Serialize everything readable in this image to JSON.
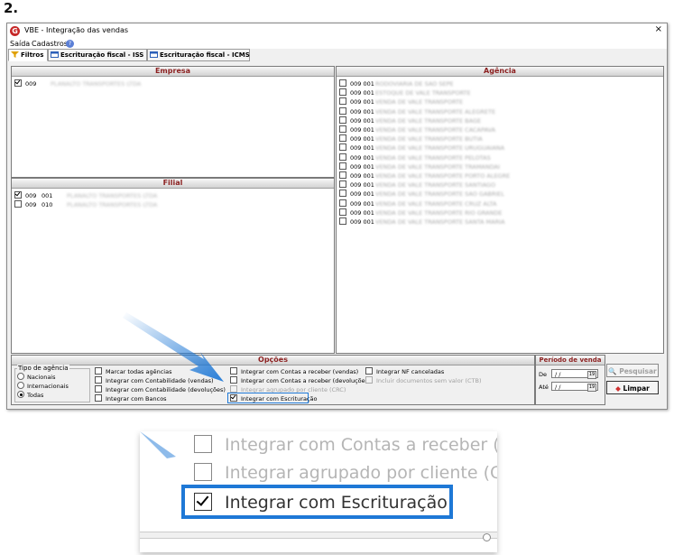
{
  "step_label": "2.",
  "window": {
    "title": "VBE - Integração das vendas",
    "close_glyph": "×",
    "app_icon_letter": "G"
  },
  "menu": {
    "items": [
      "Saída",
      "Cadastros"
    ]
  },
  "tabs": [
    {
      "label": "Filtros",
      "icon": "funnel-icon"
    },
    {
      "label": "Escrituração fiscal - ISS",
      "icon": "table-icon"
    },
    {
      "label": "Escrituração fiscal - ICMS",
      "icon": "table-icon"
    }
  ],
  "empresa": {
    "header": "Empresa",
    "rows": [
      {
        "code": "009",
        "name": "PLANALTO TRANSPORTES LTDA",
        "checked": true
      }
    ]
  },
  "filial": {
    "header": "Filial",
    "rows": [
      {
        "code": "009",
        "code2": "001",
        "name": "PLANALTO TRANSPORTES LTDA",
        "checked": true
      },
      {
        "code": "009",
        "code2": "010",
        "name": "PLANALTO TRANSPORTES LTDA",
        "checked": false
      }
    ]
  },
  "agencia": {
    "header": "Agência",
    "rows": [
      {
        "code": "009 001",
        "name": "RODOVIARIA DE SAO SEPE"
      },
      {
        "code": "009 001",
        "name": "ESTOQUE DE VALE TRANSPORTE"
      },
      {
        "code": "009 001",
        "name": "VENDA DE VALE TRANSPORTE"
      },
      {
        "code": "009 001",
        "name": "VENDA DE VALE TRANSPORTE ALEGRETE"
      },
      {
        "code": "009 001",
        "name": "VENDA DE VALE TRANSPORTE BAGE"
      },
      {
        "code": "009 001",
        "name": "VENDA DE VALE TRANSPORTE CACAPAVA"
      },
      {
        "code": "009 001",
        "name": "VENDA DE VALE TRANSPORTE BUTIA"
      },
      {
        "code": "009 001",
        "name": "VENDA DE VALE TRANSPORTE URUGUAIANA"
      },
      {
        "code": "009 001",
        "name": "VENDA DE VALE TRANSPORTE PELOTAS"
      },
      {
        "code": "009 001",
        "name": "VENDA DE VALE TRANSPORTE TRAMANDAI"
      },
      {
        "code": "009 001",
        "name": "VENDA DE VALE TRANSPORTE PORTO ALEGRE"
      },
      {
        "code": "009 001",
        "name": "VENDA DE VALE TRANSPORTE SANTIAGO"
      },
      {
        "code": "009 001",
        "name": "VENDA DE VALE TRANSPORTE SAO GABRIEL"
      },
      {
        "code": "009 001",
        "name": "VENDA DE VALE TRANSPORTE CRUZ ALTA"
      },
      {
        "code": "009 001",
        "name": "VENDA DE VALE TRANSPORTE RIO GRANDE"
      },
      {
        "code": "009 001",
        "name": "VENDA DE VALE TRANSPORTE SANTA MARIA"
      }
    ]
  },
  "opcoes": {
    "header": "Opções",
    "tipo_agencia": {
      "label": "Tipo de agência",
      "options": [
        {
          "label": "Nacionais",
          "selected": false
        },
        {
          "label": "Internacionais",
          "selected": false
        },
        {
          "label": "Todas",
          "selected": true
        }
      ]
    },
    "col1": [
      {
        "label": "Marcar todas agências",
        "checked": false,
        "disabled": false
      },
      {
        "label": "Integrar com Contabilidade (vendas)",
        "checked": false,
        "disabled": false
      },
      {
        "label": "Integrar com Contabilidade (devoluções)",
        "checked": false,
        "disabled": false
      },
      {
        "label": "Integrar com Bancos",
        "checked": false,
        "disabled": false
      }
    ],
    "col2": [
      {
        "label": "Integrar com Contas a receber (vendas)",
        "checked": false,
        "disabled": false
      },
      {
        "label": "Integrar com Contas a receber (devoluções)",
        "checked": false,
        "disabled": false
      },
      {
        "label": "Integrar agrupado por cliente (CRC)",
        "checked": false,
        "disabled": true
      },
      {
        "label": "Integrar com Escrituração",
        "checked": true,
        "disabled": false
      }
    ],
    "col3": [
      {
        "label": "Integrar NF canceladas",
        "checked": false,
        "disabled": false
      },
      {
        "label": "Incluir documentos sem valor (CTB)",
        "checked": false,
        "disabled": true
      }
    ]
  },
  "periodo": {
    "header": "Período de venda",
    "de_label": "De",
    "ate_label": "Até",
    "de_value": " / /",
    "ate_value": " / /",
    "cal_glyph": "19"
  },
  "buttons": {
    "pesquisar": "Pesquisar",
    "limpar": "Limpar"
  },
  "zoom": {
    "rows": [
      {
        "label": "Integrar com Contas a receber (",
        "checked": false,
        "dim": true
      },
      {
        "label": "Integrar agrupado por cliente (C",
        "checked": false,
        "dim": true
      },
      {
        "label": "Integrar com Escrituração",
        "checked": true,
        "dim": false
      }
    ]
  },
  "colors": {
    "highlight": "#1e78d6",
    "header_text": "#8b1f1f"
  }
}
